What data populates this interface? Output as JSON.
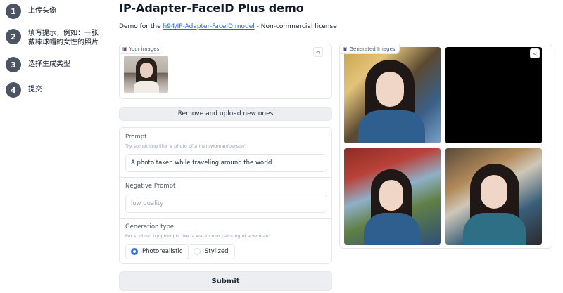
{
  "steps": [
    {
      "number": "1",
      "label": "上传头像"
    },
    {
      "number": "2",
      "label": "填写提示，例如：一张戴棒球帽的女性的照片"
    },
    {
      "number": "3",
      "label": "选择生成类型"
    },
    {
      "number": "4",
      "label": "提交"
    }
  ],
  "header": {
    "title": "IP-Adapter-FaceID Plus demo",
    "subtitle_prefix": "Demo for the ",
    "subtitle_link": "h94/IP-Adapter-FaceID model",
    "subtitle_suffix": " - Non-commercial license"
  },
  "your_images": {
    "label": "Your images"
  },
  "remove_button": {
    "label": "Remove and upload new ones"
  },
  "prompt": {
    "label": "Prompt",
    "hint": "Try something like 'a photo of a man/woman/person'",
    "value": "A photo taken while traveling around the world."
  },
  "negative_prompt": {
    "label": "Negative Prompt",
    "placeholder": "low quality"
  },
  "generation_type": {
    "label": "Generation type",
    "hint": "For stylized try prompts like 'a watercolor painting of a woman'",
    "options": [
      "Photorealistic",
      "Stylized"
    ],
    "selected": "Photorealistic"
  },
  "submit_button": {
    "label": "Submit"
  },
  "gallery": {
    "label": "Generated Images"
  },
  "colors": {
    "accent": "#3b6ef6",
    "link": "#2563eb",
    "step_circle": "#4b5563"
  },
  "icons": {
    "image": "image-icon",
    "share": "share-icon"
  }
}
